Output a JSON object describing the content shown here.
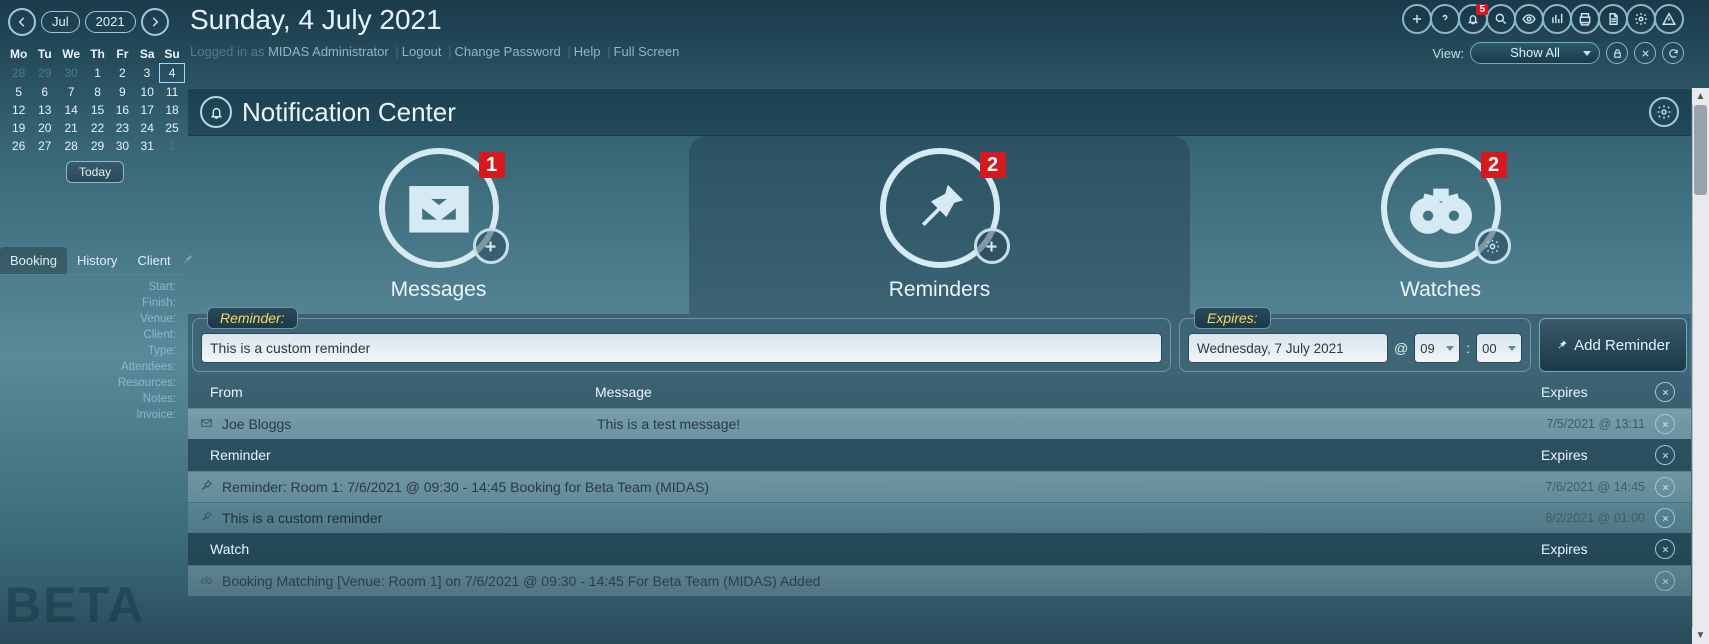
{
  "header": {
    "month": "Jul",
    "year": "2021",
    "date_title": "Sunday, 4 July 2021",
    "logged_in_as_label": "Logged in as ",
    "user": "MIDAS Administrator",
    "links": {
      "logout": "Logout",
      "change_pw": "Change Password",
      "help": "Help",
      "full_screen": "Full Screen"
    },
    "view_label": "View:",
    "view_value": "Show All",
    "bell_badge": "5"
  },
  "calendar": {
    "dow": [
      "Mo",
      "Tu",
      "We",
      "Th",
      "Fr",
      "Sa",
      "Su"
    ],
    "rows": [
      [
        "28",
        "29",
        "30",
        "1",
        "2",
        "3",
        "4"
      ],
      [
        "5",
        "6",
        "7",
        "8",
        "9",
        "10",
        "11"
      ],
      [
        "12",
        "13",
        "14",
        "15",
        "16",
        "17",
        "18"
      ],
      [
        "19",
        "20",
        "21",
        "22",
        "23",
        "24",
        "25"
      ],
      [
        "26",
        "27",
        "28",
        "29",
        "30",
        "31",
        "1"
      ]
    ],
    "dim_leading": 3,
    "dim_trailing": 1,
    "selected": "4",
    "today_label": "Today"
  },
  "left": {
    "tabs": {
      "booking": "Booking",
      "history": "History",
      "client": "Client"
    },
    "fields": [
      "Start:",
      "Finish:",
      "Venue:",
      "Client:",
      "Type:",
      "Attendees:",
      "Resources:",
      "Notes:",
      "Invoice:"
    ],
    "beta": "BETA"
  },
  "nc": {
    "title": "Notification Center",
    "tabs": {
      "messages": {
        "label": "Messages",
        "count": "1"
      },
      "reminders": {
        "label": "Reminders",
        "count": "2"
      },
      "watches": {
        "label": "Watches",
        "count": "2"
      }
    }
  },
  "form": {
    "reminder_label": "Reminder:",
    "reminder_value": "This is a custom reminder",
    "expires_label": "Expires:",
    "expires_date": "Wednesday, 7 July 2021",
    "at": "@",
    "hour": "09",
    "sep": ":",
    "minute": "00",
    "add_btn": "Add Reminder"
  },
  "list": {
    "headers": {
      "from": "From",
      "message": "Message",
      "reminder": "Reminder",
      "watch": "Watch",
      "expires": "Expires"
    },
    "messages": [
      {
        "from": "Joe Bloggs",
        "msg": "This is a test message!",
        "exp": "7/5/2021 @ 13:11"
      }
    ],
    "reminders": [
      {
        "text": "Reminder: Room 1: 7/6/2021 @ 09:30 - 14:45 Booking for Beta Team (MIDAS)",
        "exp": "7/6/2021 @ 14:45"
      },
      {
        "text": "This is a custom reminder",
        "exp": "8/2/2021 @ 01:00"
      }
    ],
    "watches": [
      {
        "text": "Booking Matching [Venue: Room 1] on 7/6/2021 @ 09:30 - 14:45 For Beta Team (MIDAS) Added",
        "exp": ""
      }
    ]
  }
}
